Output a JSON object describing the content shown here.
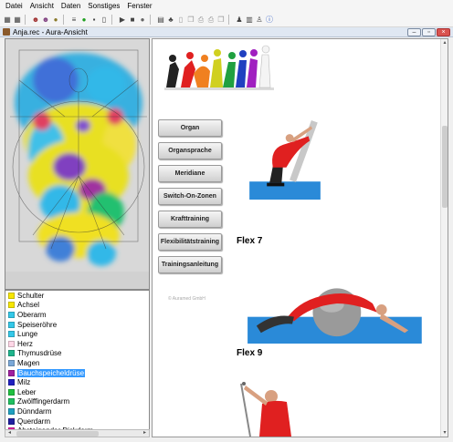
{
  "menu": [
    "Datei",
    "Ansicht",
    "Daten",
    "Sonstiges",
    "Fenster"
  ],
  "toolbar_icons": [
    "grid-icon",
    "grid-alt-icon",
    "aura-icon",
    "aura-alt-icon",
    "globe-icon",
    "lines-icon",
    "green-circle-icon",
    "save-icon",
    "document-icon",
    "play-icon",
    "stop-icon",
    "record-icon",
    "table-icon",
    "figures-icon",
    "blank-page-icon",
    "copy-icon",
    "print-icon",
    "print-alt-icon",
    "copy-alt-icon",
    "person-icon",
    "bars-icon",
    "figure-icon",
    "info-icon"
  ],
  "window": {
    "title": "Anja.rec  -  Aura-Ansicht",
    "buttons": [
      "–",
      "▫",
      "×"
    ]
  },
  "organs": [
    {
      "label": "Schulter",
      "color": "#f7e600"
    },
    {
      "label": "Achsel",
      "color": "#f7e600"
    },
    {
      "label": "Oberarm",
      "color": "#34c8e8"
    },
    {
      "label": "Speiseröhre",
      "color": "#34c8e8"
    },
    {
      "label": "Lunge",
      "color": "#34c8e8"
    },
    {
      "label": "Herz",
      "color": "#ffd6e6"
    },
    {
      "label": "Thymusdrüse",
      "color": "#1fb58c"
    },
    {
      "label": "Magen",
      "color": "#7aa8d8"
    },
    {
      "label": "Bauchspeicheldrüse",
      "color": "#a020a0"
    },
    {
      "label": "Milz",
      "color": "#2020c0"
    },
    {
      "label": "Leber",
      "color": "#20c040"
    },
    {
      "label": "Zwölffingerdarm",
      "color": "#20c060"
    },
    {
      "label": "Dünndarm",
      "color": "#20a0c0"
    },
    {
      "label": "Querdarm",
      "color": "#2020a0"
    },
    {
      "label": "Absteigender Dickdarm",
      "color": "#e020a0"
    }
  ],
  "selected_organ": "Bauchspeicheldrüse",
  "nav_buttons": [
    "Organ",
    "Organsprache",
    "Meridiane",
    "Switch-On-Zonen",
    "Krafttraining",
    "Flexibilitätstraining",
    "Trainingsanleitung"
  ],
  "copyright": "© Auramed GmbH",
  "exercises": [
    {
      "caption": "Flex 7"
    },
    {
      "caption": "Flex 9"
    },
    {
      "caption": ""
    }
  ]
}
